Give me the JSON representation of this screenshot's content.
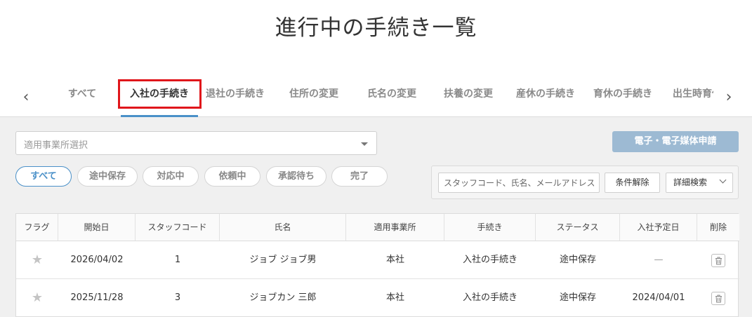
{
  "page": {
    "title": "進行中の手続き一覧"
  },
  "tabs": {
    "prev_icon": "chevron-left-icon",
    "next_icon": "chevron-right-icon",
    "items": [
      {
        "label": "すべて",
        "active": false
      },
      {
        "label": "入社の手続き",
        "active": true
      },
      {
        "label": "退社の手続き",
        "active": false
      },
      {
        "label": "住所の変更",
        "active": false
      },
      {
        "label": "氏名の変更",
        "active": false
      },
      {
        "label": "扶養の変更",
        "active": false
      },
      {
        "label": "産休の手続き",
        "active": false
      },
      {
        "label": "育休の手続き",
        "active": false
      },
      {
        "label": "出生時育休",
        "active": false
      }
    ]
  },
  "filters": {
    "office_select_placeholder": "適用事業所選択",
    "apply_button": "電子・電子媒体申請",
    "status_pills": [
      {
        "label": "すべて",
        "active": true
      },
      {
        "label": "途中保存",
        "active": false
      },
      {
        "label": "対応中",
        "active": false
      },
      {
        "label": "依頼中",
        "active": false
      },
      {
        "label": "承認待ち",
        "active": false
      },
      {
        "label": "完了",
        "active": false
      }
    ],
    "search_placeholder": "スタッフコード、氏名、メールアドレス",
    "clear_button": "条件解除",
    "advanced_search_button": "詳細検索"
  },
  "table": {
    "headers": [
      "フラグ",
      "開始日",
      "スタッフコード",
      "氏名",
      "適用事業所",
      "手続き",
      "ステータス",
      "入社予定日",
      "削除"
    ],
    "rows": [
      {
        "start_date": "2026/04/02",
        "staff_code": "1",
        "name": "ジョブ ジョブ男",
        "office": "本社",
        "procedure": "入社の手続き",
        "status": "途中保存",
        "join_date": "—"
      },
      {
        "start_date": "2025/11/28",
        "staff_code": "3",
        "name": "ジョブカン 三郎",
        "office": "本社",
        "procedure": "入社の手続き",
        "status": "途中保存",
        "join_date": "2024/04/01"
      }
    ]
  },
  "colors": {
    "accent": "#4a90c8",
    "highlight": "#e0161b",
    "apply_button": "#9dbad3"
  }
}
